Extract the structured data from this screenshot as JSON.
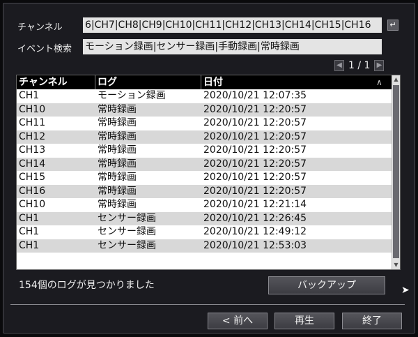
{
  "filter": {
    "channel_label": "チャンネル",
    "channel_value": "6|CH7|CH8|CH9|CH10|CH11|CH12|CH13|CH14|CH15|CH16",
    "event_label": "イベント検索",
    "event_value": "モーション録画|センサー録画|手動録画|常時録画"
  },
  "pager": {
    "text": "1 / 1"
  },
  "table": {
    "headers": [
      "チャンネル",
      "ログ",
      "日付"
    ],
    "rows": [
      [
        "CH1",
        "モーション録画",
        "2020/10/21 12:07:35"
      ],
      [
        "CH10",
        "常時録画",
        "2020/10/21 12:20:57"
      ],
      [
        "CH11",
        "常時録画",
        "2020/10/21 12:20:57"
      ],
      [
        "CH12",
        "常時録画",
        "2020/10/21 12:20:57"
      ],
      [
        "CH13",
        "常時録画",
        "2020/10/21 12:20:57"
      ],
      [
        "CH14",
        "常時録画",
        "2020/10/21 12:20:57"
      ],
      [
        "CH15",
        "常時録画",
        "2020/10/21 12:20:57"
      ],
      [
        "CH16",
        "常時録画",
        "2020/10/21 12:20:57"
      ],
      [
        "CH10",
        "常時録画",
        "2020/10/21 12:21:14"
      ],
      [
        "CH1",
        "センサー録画",
        "2020/10/21 12:26:45"
      ],
      [
        "CH1",
        "センサー録画",
        "2020/10/21 12:49:12"
      ],
      [
        "CH1",
        "センサー録画",
        "2020/10/21 12:53:03"
      ]
    ]
  },
  "status": "154個のログが見つかりました",
  "buttons": {
    "backup": "バックアップ",
    "prev": "< 前へ",
    "play": "再生",
    "done": "終了"
  }
}
